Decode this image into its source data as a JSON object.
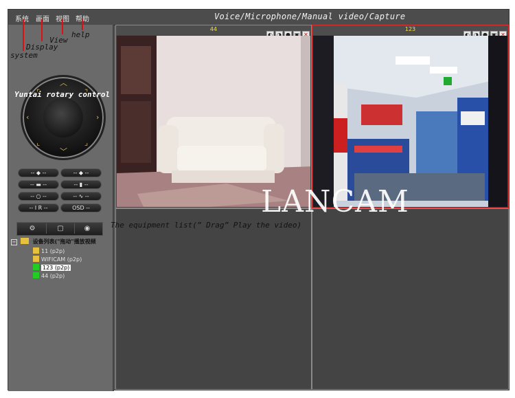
{
  "menu": [
    {
      "label": "系统"
    },
    {
      "label": "画面"
    },
    {
      "label": "视图"
    },
    {
      "label": "帮助"
    }
  ],
  "window_title": "Voice/Microphone/Manual video/Capture",
  "annotations": {
    "system": "system",
    "display": "Display",
    "view": "View",
    "help": "help",
    "ptz": "Yuntai rotary control",
    "equipment": "The equipment list(” Drag” Play the video)"
  },
  "ptz_buttons": [
    {
      "label": "-- ◆ --"
    },
    {
      "label": "-- ◆ --"
    },
    {
      "label": "-- ▬ --"
    },
    {
      "label": "-- ▮ --"
    },
    {
      "label": "-- ○ --"
    },
    {
      "label": "-- ∿ --"
    },
    {
      "label": "-- I R --"
    },
    {
      "label": "OSD --"
    }
  ],
  "tabs": [
    {
      "icon": "gear-icon",
      "glyph": "⚙"
    },
    {
      "icon": "clip-icon",
      "glyph": "▢"
    },
    {
      "icon": "play-icon",
      "glyph": "◉"
    }
  ],
  "device_tree": {
    "root_label": "设备列表(\"拖动\"播放视频",
    "items": [
      {
        "label": "11 (p2p)",
        "status": "offline"
      },
      {
        "label": "WIFICAM (p2p)",
        "status": "offline"
      },
      {
        "label": "123 (p2p)",
        "status": "online",
        "selected": true
      },
      {
        "label": "44 (p2p)",
        "status": "online"
      }
    ]
  },
  "video_cells": [
    {
      "title": "44",
      "active": false
    },
    {
      "title": "123",
      "active": true
    },
    {
      "title": "",
      "active": false
    },
    {
      "title": "",
      "active": false
    }
  ],
  "cell_icon_names": [
    "mic-icon",
    "speaker-icon",
    "record-icon",
    "camera-icon",
    "close-icon"
  ],
  "watermark": "LANCAM",
  "colors": {
    "accent": "#f4e04a",
    "close": "#d01010",
    "annotation_line": "#e01010",
    "online": "#22cc22",
    "offline": "#e8c040"
  }
}
